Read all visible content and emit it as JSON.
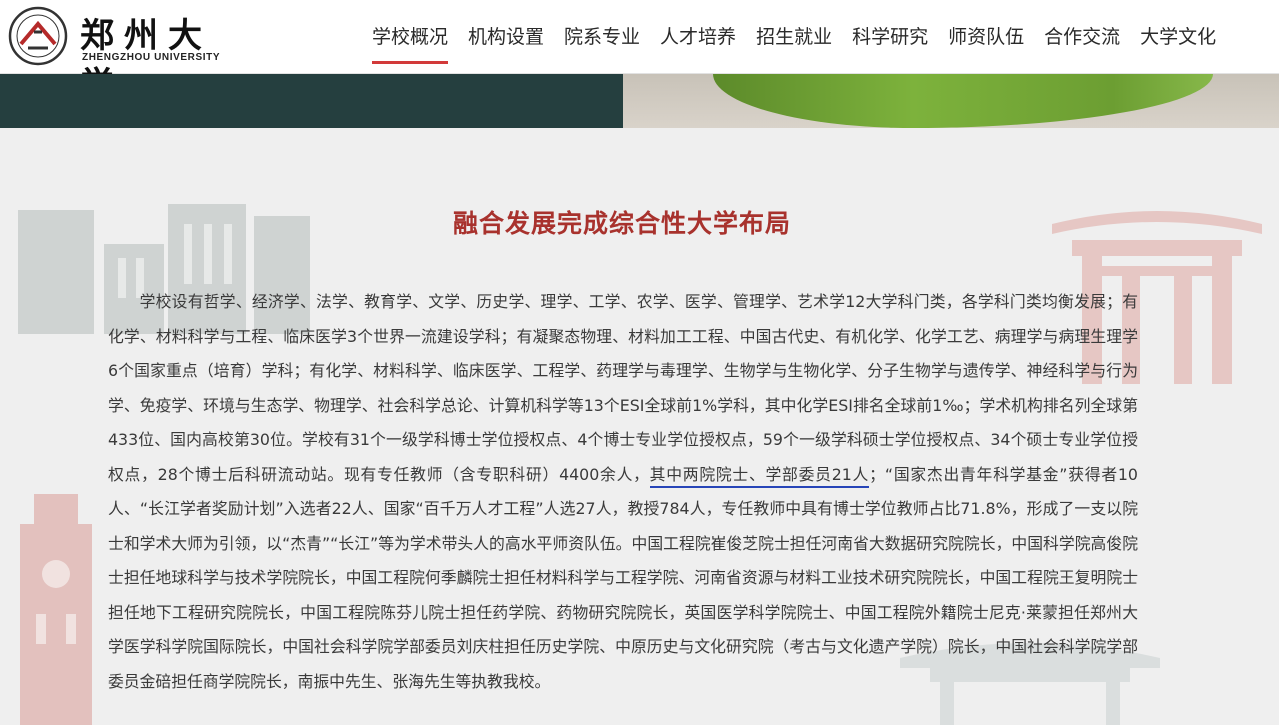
{
  "header": {
    "logo_cn": "郑州大学",
    "logo_en": "ZHENGZHOU UNIVERSITY",
    "nav": [
      {
        "label": "学校概况",
        "active": true
      },
      {
        "label": "机构设置",
        "active": false
      },
      {
        "label": "院系专业",
        "active": false
      },
      {
        "label": "人才培养",
        "active": false
      },
      {
        "label": "招生就业",
        "active": false
      },
      {
        "label": "科学研究",
        "active": false
      },
      {
        "label": "师资队伍",
        "active": false
      },
      {
        "label": "合作交流",
        "active": false
      },
      {
        "label": "大学文化",
        "active": false
      }
    ]
  },
  "colors": {
    "accent": "#d23a3a",
    "title": "#a8322d",
    "banner": "#253f3f",
    "underline": "#2745b8"
  },
  "article": {
    "title": "融合发展完成综合性大学布局",
    "text_before": "学校设有哲学、经济学、法学、教育学、文学、历史学、理学、工学、农学、医学、管理学、艺术学12大学科门类，各学科门类均衡发展；有化学、材料科学与工程、临床医学3个世界一流建设学科；有凝聚态物理、材料加工工程、中国古代史、有机化学、化学工艺、病理学与病理生理学6个国家重点（培育）学科；有化学、材料科学、临床医学、工程学、药理学与毒理学、生物学与生物化学、分子生物学与遗传学、神经科学与行为学、免疫学、环境与生态学、物理学、社会科学总论、计算机科学等13个ESI全球前1%学科，其中化学ESI排名全球前1‰；学术机构排名列全球第433位、国内高校第30位。学校有31个一级学科博士学位授权点、4个博士专业学位授权点，59个一级学科硕士学位授权点、34个硕士专业学位授权点，28个博士后科研流动站。现有专任教师（含专职科研）4400余人，",
    "text_underlined": "其中两院院士、学部委员21人",
    "text_after": "；“国家杰出青年科学基金”获得者10人、“长江学者奖励计划”入选者22人、国家“百千万人才工程”人选27人，教授784人，专任教师中具有博士学位教师占比71.8%，形成了一支以院士和学术大师为引领，以“杰青”“长江”等为学术带头人的高水平师资队伍。中国工程院崔俊芝院士担任河南省大数据研究院院长，中国科学院高俊院士担任地球科学与技术学院院长，中国工程院何季麟院士担任材料科学与工程学院、河南省资源与材料工业技术研究院院长，中国工程院王复明院士担任地下工程研究院院长，中国工程院陈芬儿院士担任药学院、药物研究院院长，英国医学科学院院士、中国工程院外籍院士尼克·莱蒙担任郑州大学医学科学院国际院长，中国社会科学院学部委员刘庆柱担任历史学院、中原历史与文化研究院（考古与文化遗产学院）院长，中国社会科学院学部委员金碚担任商学院院长，南振中先生、张海先生等执教我校。"
  }
}
